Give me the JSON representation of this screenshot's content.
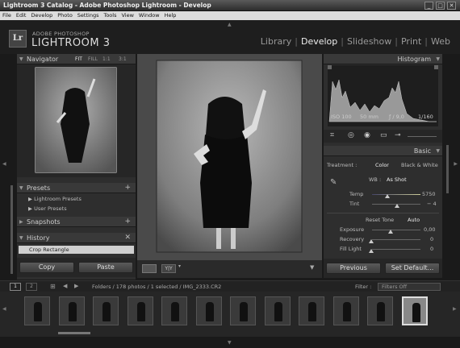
{
  "window": {
    "title": "Lightroom 3 Catalog - Adobe Photoshop Lightroom - Develop",
    "minimize": "_",
    "maximize": "□",
    "close": "✕"
  },
  "menu": [
    "File",
    "Edit",
    "Develop",
    "Photo",
    "Settings",
    "Tools",
    "View",
    "Window",
    "Help"
  ],
  "brand": {
    "logo": "Lr",
    "line1": "ADOBE PHOTOSHOP",
    "line2": "LIGHTROOM 3"
  },
  "modules": [
    {
      "label": "Library",
      "active": false
    },
    {
      "label": "Develop",
      "active": true
    },
    {
      "label": "Slideshow",
      "active": false
    },
    {
      "label": "Print",
      "active": false
    },
    {
      "label": "Web",
      "active": false
    }
  ],
  "left_panel": {
    "navigator": {
      "title": "Navigator",
      "zoom": [
        "FIT",
        "FILL",
        "1:1",
        "3:1"
      ]
    },
    "presets": {
      "title": "Presets",
      "items": [
        "Lightroom Presets",
        "User Presets"
      ]
    },
    "snapshots": {
      "title": "Snapshots"
    },
    "history": {
      "title": "History",
      "items": [
        "Crop Rectangle"
      ]
    },
    "copy_button": "Copy",
    "paste_button": "Paste"
  },
  "right_panel": {
    "histogram": {
      "title": "Histogram",
      "iso": "ISO 100",
      "focal": "50 mm",
      "aperture": "ƒ / 9,0",
      "shutter": "1/160"
    },
    "basic": {
      "title": "Basic",
      "treatment_label": "Treatment :",
      "treatment_color": "Color",
      "treatment_bw": "Black & White",
      "wb_label": "WB :",
      "wb_value": "As Shot",
      "temp_label": "Temp",
      "temp_value": "5750",
      "tint_label": "Tint",
      "tint_value": "− 4",
      "tone_label": "Reset Tone",
      "tone_auto": "Auto",
      "exposure_label": "Exposure",
      "exposure_value": "0,00",
      "recovery_label": "Recovery",
      "recovery_value": "0",
      "filllight_label": "Fill Light",
      "filllight_value": "0"
    },
    "previous_button": "Previous",
    "set_default_button": "Set Default..."
  },
  "filmstrip_bar": {
    "page1": "1",
    "page2": "2",
    "path": "Folders / 178 photos / 1 selected / IMG_2333.CR2",
    "filter_label": "Filter :",
    "filter_value": "Filters Off"
  },
  "thumbnails": 12,
  "colors": {
    "background": "#1a1a1a",
    "panel": "#2e2e2e",
    "center": "#4a4a4a",
    "photo_bg": "#8a8a8a"
  }
}
